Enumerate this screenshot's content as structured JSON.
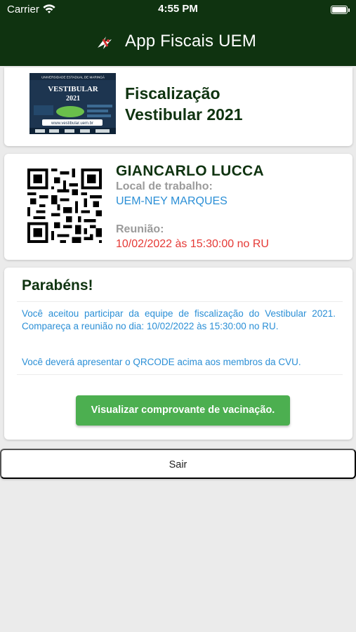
{
  "status_bar": {
    "carrier": "Carrier",
    "time": "4:55 PM",
    "icons": [
      "wifi-icon",
      "battery-icon"
    ]
  },
  "header": {
    "logo_icon": "uem-logo-icon",
    "title": "App Fiscais UEM",
    "background_color": "#0f3310"
  },
  "banner": {
    "image": {
      "institution": "UNIVERSIDADE ESTADUAL DE MARINGÁ",
      "headline": "VESTIBULAR",
      "year": "2021",
      "website": "www.vestibular.uem.br"
    },
    "title": "Fiscalização Vestibular 2021"
  },
  "credential": {
    "qr_icon": "qr-code-icon",
    "name": "GIANCARLO LUCCA",
    "workplace_label": "Local de trabalho:",
    "workplace_value": "UEM-NEY MARQUES",
    "meeting_label": "Reunião:",
    "meeting_value": "10/02/2022 às 15:30:00 no RU"
  },
  "message": {
    "title": "Parabéns!",
    "paragraph_1": "Você aceitou participar da equipe de fiscalização do Vestibular 2021. Compareça a reunião no dia: 10/02/2022 às 15:30:00 no RU.",
    "paragraph_2": "Você deverá apresentar o QRCODE acima aos membros da CVU.",
    "vaccination_button": "Visualizar comprovante de vacinação."
  },
  "actions": {
    "exit_button": "Sair"
  },
  "colors": {
    "dark_green": "#0f3310",
    "button_green": "#4caf50",
    "link_blue": "#2b8fd6",
    "alert_red": "#e53935",
    "label_gray": "#9b9b9b"
  }
}
